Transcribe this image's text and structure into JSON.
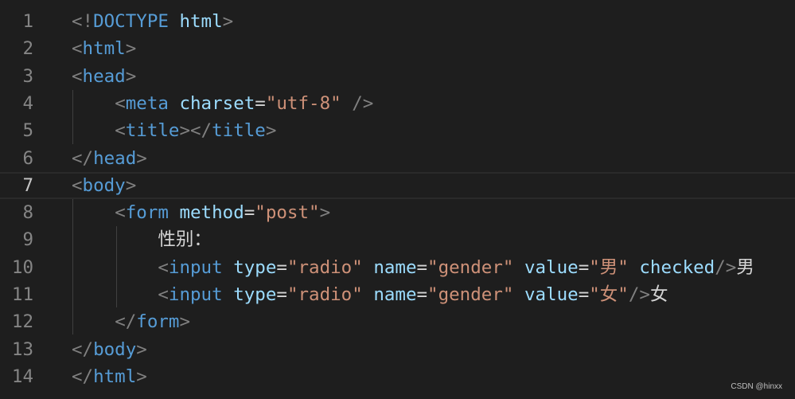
{
  "editor": {
    "watermark": "CSDN @hinxx",
    "lines": [
      {
        "n": "1",
        "tokens": [
          [
            "punc",
            "<!"
          ],
          [
            "tag",
            "DOCTYPE"
          ],
          [
            "txt",
            " "
          ],
          [
            "attr",
            "html"
          ],
          [
            "punc",
            ">"
          ]
        ]
      },
      {
        "n": "2",
        "tokens": [
          [
            "punc",
            "<"
          ],
          [
            "tag",
            "html"
          ],
          [
            "punc",
            ">"
          ]
        ]
      },
      {
        "n": "3",
        "tokens": [
          [
            "punc",
            "<"
          ],
          [
            "tag",
            "head"
          ],
          [
            "punc",
            ">"
          ]
        ]
      },
      {
        "n": "4",
        "tokens": [
          [
            "txt",
            "    "
          ],
          [
            "punc",
            "<"
          ],
          [
            "tag",
            "meta"
          ],
          [
            "txt",
            " "
          ],
          [
            "attr",
            "charset"
          ],
          [
            "eq",
            "="
          ],
          [
            "str",
            "\"utf-8\""
          ],
          [
            "txt",
            " "
          ],
          [
            "punc",
            "/>"
          ]
        ]
      },
      {
        "n": "5",
        "tokens": [
          [
            "txt",
            "    "
          ],
          [
            "punc",
            "<"
          ],
          [
            "tag",
            "title"
          ],
          [
            "punc",
            "></"
          ],
          [
            "tag",
            "title"
          ],
          [
            "punc",
            ">"
          ]
        ]
      },
      {
        "n": "6",
        "tokens": [
          [
            "punc",
            "</"
          ],
          [
            "tag",
            "head"
          ],
          [
            "punc",
            ">"
          ]
        ]
      },
      {
        "n": "7",
        "tokens": [
          [
            "punc",
            "<"
          ],
          [
            "tag",
            "body"
          ],
          [
            "punc",
            ">"
          ]
        ]
      },
      {
        "n": "8",
        "tokens": [
          [
            "txt",
            "    "
          ],
          [
            "punc",
            "<"
          ],
          [
            "tag",
            "form"
          ],
          [
            "txt",
            " "
          ],
          [
            "attr",
            "method"
          ],
          [
            "eq",
            "="
          ],
          [
            "str",
            "\"post\""
          ],
          [
            "punc",
            ">"
          ]
        ]
      },
      {
        "n": "9",
        "tokens": [
          [
            "txt",
            "        性别："
          ]
        ]
      },
      {
        "n": "10",
        "tokens": [
          [
            "txt",
            "        "
          ],
          [
            "punc",
            "<"
          ],
          [
            "tag",
            "input"
          ],
          [
            "txt",
            " "
          ],
          [
            "attr",
            "type"
          ],
          [
            "eq",
            "="
          ],
          [
            "str",
            "\"radio\""
          ],
          [
            "txt",
            " "
          ],
          [
            "attr",
            "name"
          ],
          [
            "eq",
            "="
          ],
          [
            "str",
            "\"gender\""
          ],
          [
            "txt",
            " "
          ],
          [
            "attr",
            "value"
          ],
          [
            "eq",
            "="
          ],
          [
            "str",
            "\"男\""
          ],
          [
            "txt",
            " "
          ],
          [
            "attr",
            "checked"
          ],
          [
            "punc",
            "/>"
          ],
          [
            "txt",
            "男"
          ]
        ]
      },
      {
        "n": "11",
        "tokens": [
          [
            "txt",
            "        "
          ],
          [
            "punc",
            "<"
          ],
          [
            "tag",
            "input"
          ],
          [
            "txt",
            " "
          ],
          [
            "attr",
            "type"
          ],
          [
            "eq",
            "="
          ],
          [
            "str",
            "\"radio\""
          ],
          [
            "txt",
            " "
          ],
          [
            "attr",
            "name"
          ],
          [
            "eq",
            "="
          ],
          [
            "str",
            "\"gender\""
          ],
          [
            "txt",
            " "
          ],
          [
            "attr",
            "value"
          ],
          [
            "eq",
            "="
          ],
          [
            "str",
            "\"女\""
          ],
          [
            "punc",
            "/>"
          ],
          [
            "txt",
            "女"
          ]
        ]
      },
      {
        "n": "12",
        "tokens": [
          [
            "txt",
            "    "
          ],
          [
            "punc",
            "</"
          ],
          [
            "tag",
            "form"
          ],
          [
            "punc",
            ">"
          ]
        ]
      },
      {
        "n": "13",
        "tokens": [
          [
            "punc",
            "</"
          ],
          [
            "tag",
            "body"
          ],
          [
            "punc",
            ">"
          ]
        ]
      },
      {
        "n": "14",
        "tokens": [
          [
            "punc",
            "</"
          ],
          [
            "tag",
            "html"
          ],
          [
            "punc",
            ">"
          ]
        ]
      }
    ],
    "active_line": "7"
  }
}
